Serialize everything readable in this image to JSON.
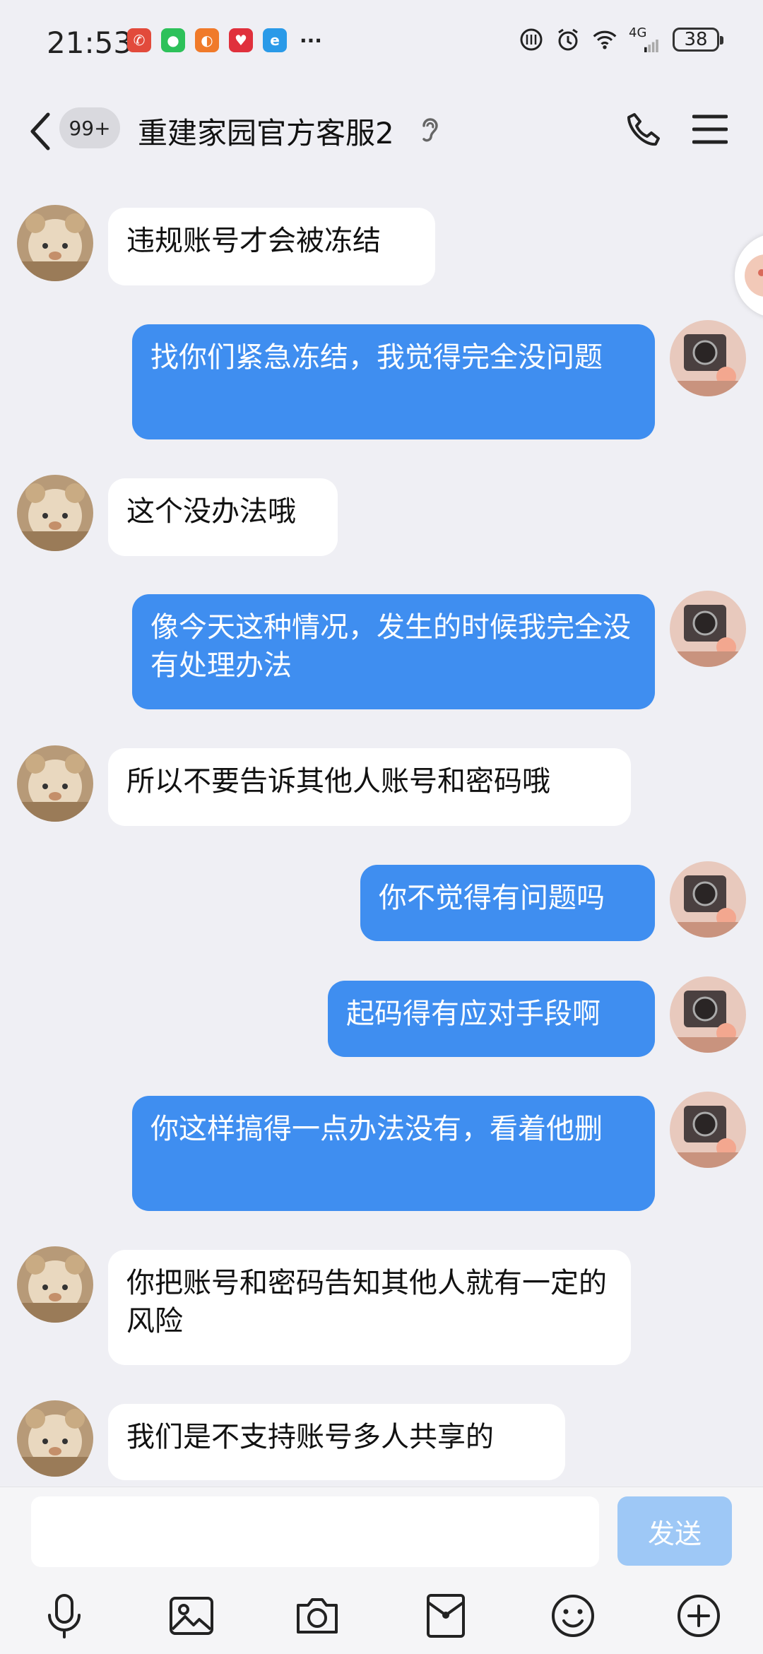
{
  "status": {
    "time": "21:53",
    "network": "4G",
    "signal_bars": "6",
    "battery": "38"
  },
  "header": {
    "unread": "99+",
    "title": "重建家园官方客服2"
  },
  "messages": [
    {
      "side": "in",
      "text": "违规账号才会被冻结"
    },
    {
      "side": "out",
      "text": "找你们紧急冻结，我觉得完全没问题"
    },
    {
      "side": "in",
      "text": "这个没办法哦"
    },
    {
      "side": "out",
      "text": "像今天这种情况，发生的时候我完全没有处理办法"
    },
    {
      "side": "in",
      "text": "所以不要告诉其他人账号和密码哦"
    },
    {
      "side": "out",
      "text": "你不觉得有问题吗"
    },
    {
      "side": "out",
      "text": "起码得有应对手段啊"
    },
    {
      "side": "out",
      "text": "你这样搞得一点办法没有，看着他删"
    },
    {
      "side": "in",
      "text": "你把账号和密码告知其他人就有一定的风险"
    },
    {
      "side": "in",
      "text": "我们是不支持账号多人共享的"
    }
  ],
  "input": {
    "value": "",
    "send_label": "发送"
  },
  "colors": {
    "outgoing_bubble": "#3f8ef0",
    "incoming_bubble": "#ffffff",
    "background": "#efeff4",
    "send_disabled": "#9ec8f6"
  }
}
